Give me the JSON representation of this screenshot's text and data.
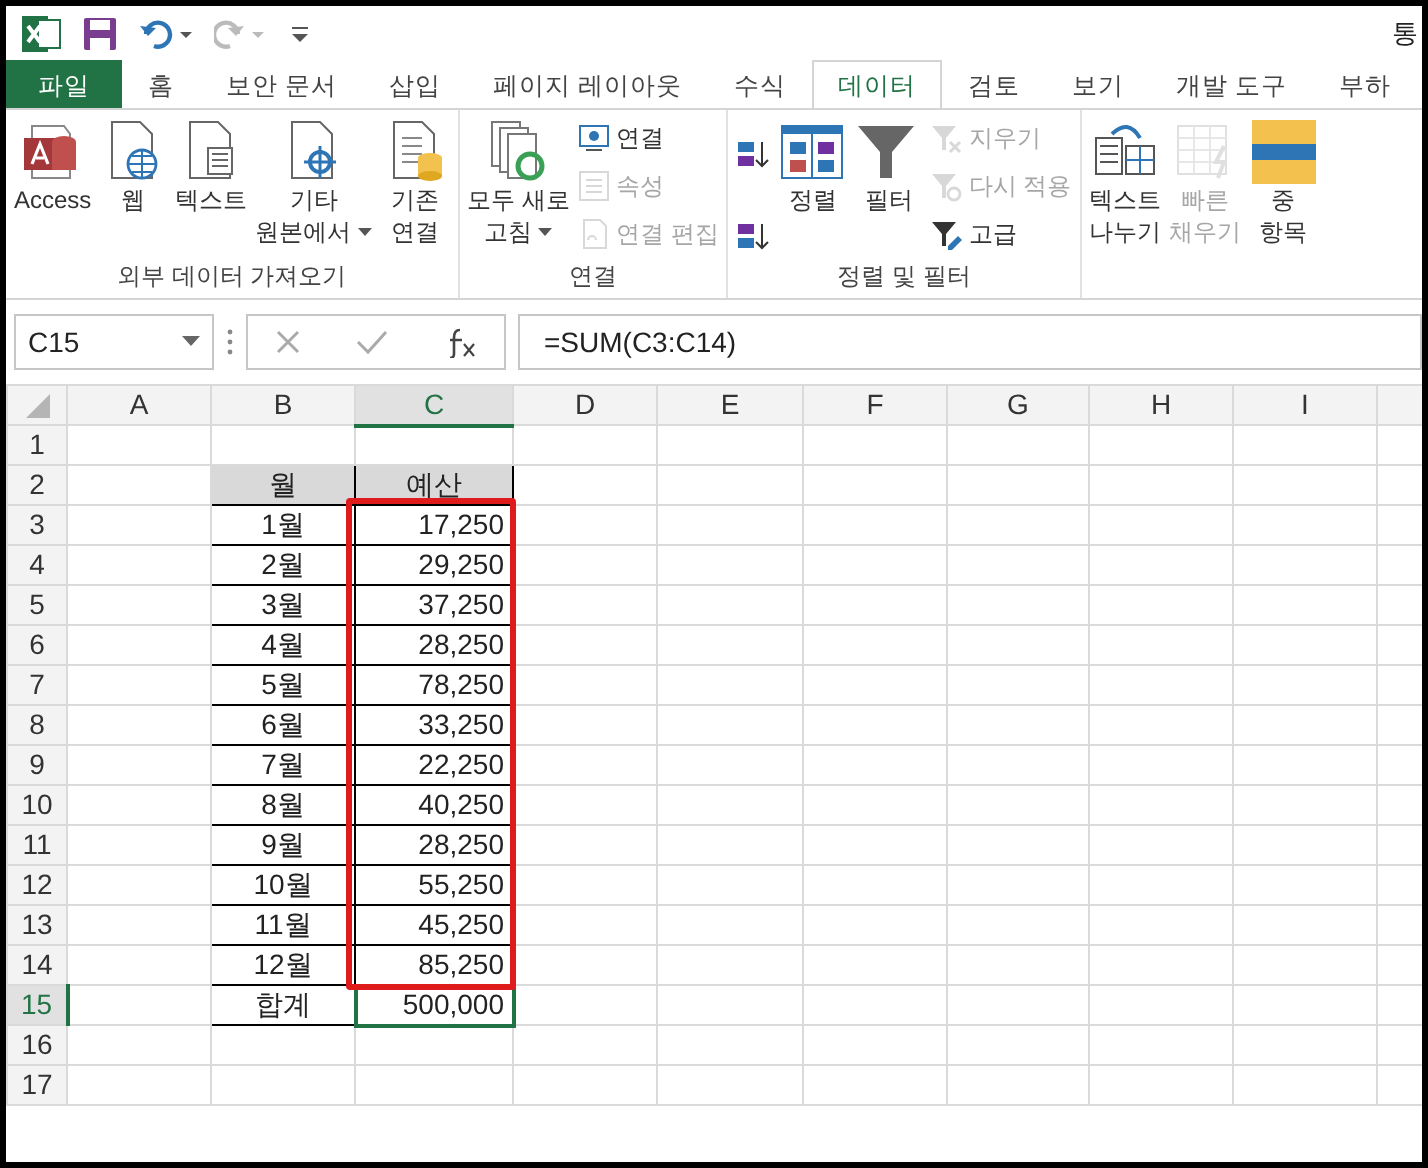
{
  "window": {
    "title": "통"
  },
  "tabs": [
    {
      "label": "파일",
      "kind": "file",
      "selected": false
    },
    {
      "label": "홈",
      "kind": "tab",
      "selected": false
    },
    {
      "label": "보안 문서",
      "kind": "tab",
      "selected": false
    },
    {
      "label": "삽입",
      "kind": "tab",
      "selected": false
    },
    {
      "label": "페이지 레이아웃",
      "kind": "tab",
      "selected": false
    },
    {
      "label": "수식",
      "kind": "tab",
      "selected": false
    },
    {
      "label": "데이터",
      "kind": "tab",
      "selected": true
    },
    {
      "label": "검토",
      "kind": "tab",
      "selected": false
    },
    {
      "label": "보기",
      "kind": "tab",
      "selected": false
    },
    {
      "label": "개발 도구",
      "kind": "tab",
      "selected": false
    },
    {
      "label": "부하",
      "kind": "tab",
      "selected": false
    }
  ],
  "ribbon": {
    "groups": [
      {
        "label": "외부 데이터 가져오기",
        "items": [
          {
            "kind": "large",
            "lines": [
              "Access"
            ],
            "disabled": false
          },
          {
            "kind": "large",
            "lines": [
              "웹"
            ],
            "disabled": false
          },
          {
            "kind": "large",
            "lines": [
              "텍스트"
            ],
            "disabled": false
          },
          {
            "kind": "large",
            "lines": [
              "기타",
              "원본에서"
            ],
            "disabled": false,
            "dropdown": true
          },
          {
            "kind": "large",
            "lines": [
              "기존",
              "연결"
            ],
            "disabled": false
          }
        ]
      },
      {
        "label": "연결",
        "items": [
          {
            "kind": "large",
            "lines": [
              "모두 새로",
              "고침"
            ],
            "disabled": false,
            "dropdown": true
          },
          {
            "kind": "small",
            "lines": [
              "연결"
            ],
            "disabled": false
          },
          {
            "kind": "small",
            "lines": [
              "속성"
            ],
            "disabled": true
          },
          {
            "kind": "small",
            "lines": [
              "연결 편집"
            ],
            "disabled": true
          }
        ]
      },
      {
        "label": "정렬 및 필터",
        "items": [
          {
            "kind": "iconpair",
            "disabled": false
          },
          {
            "kind": "large",
            "lines": [
              "정렬"
            ],
            "disabled": false
          },
          {
            "kind": "large",
            "lines": [
              "필터"
            ],
            "disabled": false
          },
          {
            "kind": "small",
            "lines": [
              "지우기"
            ],
            "disabled": true
          },
          {
            "kind": "small",
            "lines": [
              "다시 적용"
            ],
            "disabled": true
          },
          {
            "kind": "small",
            "lines": [
              "고급"
            ],
            "disabled": false
          }
        ]
      },
      {
        "items": [
          {
            "kind": "large",
            "lines": [
              "텍스트",
              "나누기"
            ],
            "disabled": false
          },
          {
            "kind": "large",
            "lines": [
              "빠른",
              "채우기"
            ],
            "disabled": true
          },
          {
            "kind": "large",
            "lines": [
              "중",
              "항목"
            ],
            "disabled": false
          }
        ]
      }
    ]
  },
  "formula_bar": {
    "name_box": "C15",
    "formula": "=SUM(C3:C14)"
  },
  "sheet": {
    "columns": [
      {
        "label": "A",
        "selected": false
      },
      {
        "label": "B",
        "selected": false
      },
      {
        "label": "C",
        "selected": true
      },
      {
        "label": "D",
        "selected": false
      },
      {
        "label": "E",
        "selected": false
      },
      {
        "label": "F",
        "selected": false
      },
      {
        "label": "G",
        "selected": false
      },
      {
        "label": "H",
        "selected": false
      },
      {
        "label": "I",
        "selected": false
      }
    ],
    "row_numbers": [
      {
        "label": "1",
        "selected": false
      },
      {
        "label": "2",
        "selected": false
      },
      {
        "label": "3",
        "selected": false
      },
      {
        "label": "4",
        "selected": false
      },
      {
        "label": "5",
        "selected": false
      },
      {
        "label": "6",
        "selected": false
      },
      {
        "label": "7",
        "selected": false
      },
      {
        "label": "8",
        "selected": false
      },
      {
        "label": "9",
        "selected": false
      },
      {
        "label": "10",
        "selected": false
      },
      {
        "label": "11",
        "selected": false
      },
      {
        "label": "12",
        "selected": false
      },
      {
        "label": "13",
        "selected": false
      },
      {
        "label": "14",
        "selected": false
      },
      {
        "label": "15",
        "selected": true
      },
      {
        "label": "16",
        "selected": false
      },
      {
        "label": "17",
        "selected": false
      }
    ],
    "table": {
      "header": [
        "월",
        "예산"
      ],
      "budget_highlighted": true,
      "rows": [
        {
          "month": "1월",
          "budget": "17,250"
        },
        {
          "month": "2월",
          "budget": "29,250"
        },
        {
          "month": "3월",
          "budget": "37,250"
        },
        {
          "month": "4월",
          "budget": "28,250"
        },
        {
          "month": "5월",
          "budget": "78,250"
        },
        {
          "month": "6월",
          "budget": "33,250"
        },
        {
          "month": "7월",
          "budget": "22,250"
        },
        {
          "month": "8월",
          "budget": "40,250"
        },
        {
          "month": "9월",
          "budget": "28,250"
        },
        {
          "month": "10월",
          "budget": "55,250"
        },
        {
          "month": "11월",
          "budget": "45,250"
        },
        {
          "month": "12월",
          "budget": "85,250"
        }
      ],
      "total": {
        "label": "합계",
        "value": "500,000",
        "selected": true
      }
    }
  }
}
